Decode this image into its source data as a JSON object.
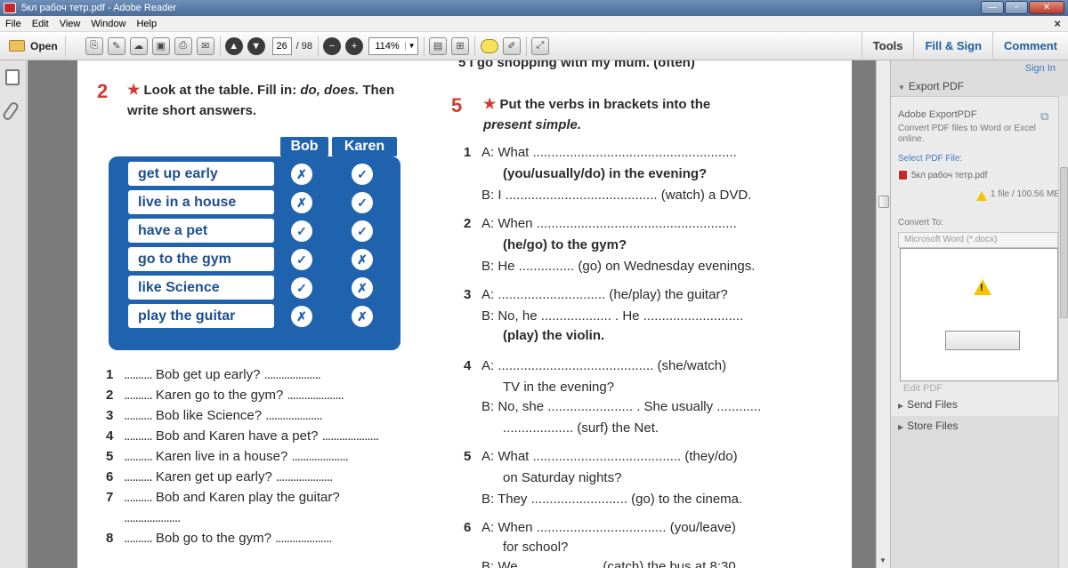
{
  "window": {
    "title": "5кл рабоч тетр.pdf - Adobe Reader"
  },
  "menu": [
    "File",
    "Edit",
    "View",
    "Window",
    "Help"
  ],
  "toolbar": {
    "open_label": "Open",
    "page_current": "26",
    "page_total": "/ 98",
    "zoom": "114%",
    "tabs": {
      "tools": "Tools",
      "fill_sign": "Fill & Sign",
      "comment": "Comment"
    }
  },
  "doc": {
    "top_cut": "5   I go shopping with my mum. (often)",
    "ex2": {
      "num": "2",
      "title_line1_a": "Look at the table. Fill in:",
      "title_line1_b": "do, does.",
      "title_line1_c": "Then",
      "title_line2": "write short answers.",
      "headers": [
        "Bob",
        "Karen"
      ],
      "rows": [
        {
          "label": "get up early",
          "bob": "✗",
          "karen": "✓"
        },
        {
          "label": "live in a house",
          "bob": "✗",
          "karen": "✓"
        },
        {
          "label": "have a pet",
          "bob": "✓",
          "karen": "✓"
        },
        {
          "label": "go to the gym",
          "bob": "✓",
          "karen": "✗"
        },
        {
          "label": "like Science",
          "bob": "✓",
          "karen": "✗"
        },
        {
          "label": "play the guitar",
          "bob": "✗",
          "karen": "✗"
        }
      ],
      "questions": [
        {
          "n": "1",
          "pre": "..........",
          "text": "Bob get up early?",
          "post": "...................."
        },
        {
          "n": "2",
          "pre": "..........",
          "text": "Karen go to the gym?",
          "post": "...................."
        },
        {
          "n": "3",
          "pre": "..........",
          "text": "Bob like Science?",
          "post": "...................."
        },
        {
          "n": "4",
          "pre": "..........",
          "text": "Bob and Karen have a pet?",
          "post": "...................."
        },
        {
          "n": "5",
          "pre": "..........",
          "text": "Karen live in a house?",
          "post": "...................."
        },
        {
          "n": "6",
          "pre": "..........",
          "text": "Karen get up early?",
          "post": "...................."
        },
        {
          "n": "7",
          "pre": "..........",
          "text": "Bob and Karen play the guitar?",
          "post": ""
        },
        {
          "n": "",
          "pre": "....................",
          "text": "",
          "post": ""
        },
        {
          "n": "8",
          "pre": "..........",
          "text": "Bob go to the gym?",
          "post": "...................."
        }
      ]
    },
    "ex5": {
      "num": "5",
      "title_line1": "Put the verbs in brackets into the",
      "title_line2": "present simple.",
      "lines": [
        {
          "n": "1",
          "t": "A:  What ......................................................."
        },
        {
          "n": "",
          "t": "(you/usually/do) in the evening?"
        },
        {
          "n": "",
          "t": "B:  I ......................................... (watch) a DVD."
        },
        {
          "n": "2",
          "t": "A:  When ......................................................"
        },
        {
          "n": "",
          "t": "(he/go) to the gym?"
        },
        {
          "n": "",
          "t": "B:  He ............... (go) on Wednesday evenings."
        },
        {
          "n": "3",
          "t": "A:   ............................. (he/play) the guitar?"
        },
        {
          "n": "",
          "t": "B:  No, he ................... . He ..........................."
        },
        {
          "n": "",
          "t": "(play) the violin."
        },
        {
          "n": "4",
          "t": "A:   .......................................... (she/watch)"
        },
        {
          "n": "",
          "t": "TV in the evening?"
        },
        {
          "n": "",
          "t": "B:  No, she ....................... . She usually ............"
        },
        {
          "n": "",
          "t": "................... (surf) the Net."
        },
        {
          "n": "5",
          "t": "A:  What ........................................ (they/do)"
        },
        {
          "n": "",
          "t": "on Saturday nights?"
        },
        {
          "n": "",
          "t": "B:  They .......................... (go) to the cinema."
        },
        {
          "n": "6",
          "t": "A:  When ................................... (you/leave)"
        },
        {
          "n": "",
          "t": "for school?"
        },
        {
          "n": "",
          "t": "B:  We ..................... (catch) the bus at 8:30."
        }
      ]
    }
  },
  "rightpane": {
    "sign_in": "Sign In",
    "export_pdf": "Export PDF",
    "adobe_exportpdf": "Adobe ExportPDF",
    "convert_desc_1": "Convert PDF files to Word or Excel",
    "convert_desc_2": "online.",
    "select_pdf": "Select PDF File:",
    "file_name": "5кл рабоч тетр.pdf",
    "file_count": "1 file / 100.56 ME",
    "convert_to": "Convert To:",
    "format": "Microsoft Word (*.docx)",
    "edit_pdf": "Edit PDF",
    "send_files": "Send Files",
    "store_files": "Store Files"
  },
  "colors": {
    "accent": "#1f63ae",
    "exercise_red": "#d23a2f",
    "link_blue": "#3c7cc2"
  }
}
